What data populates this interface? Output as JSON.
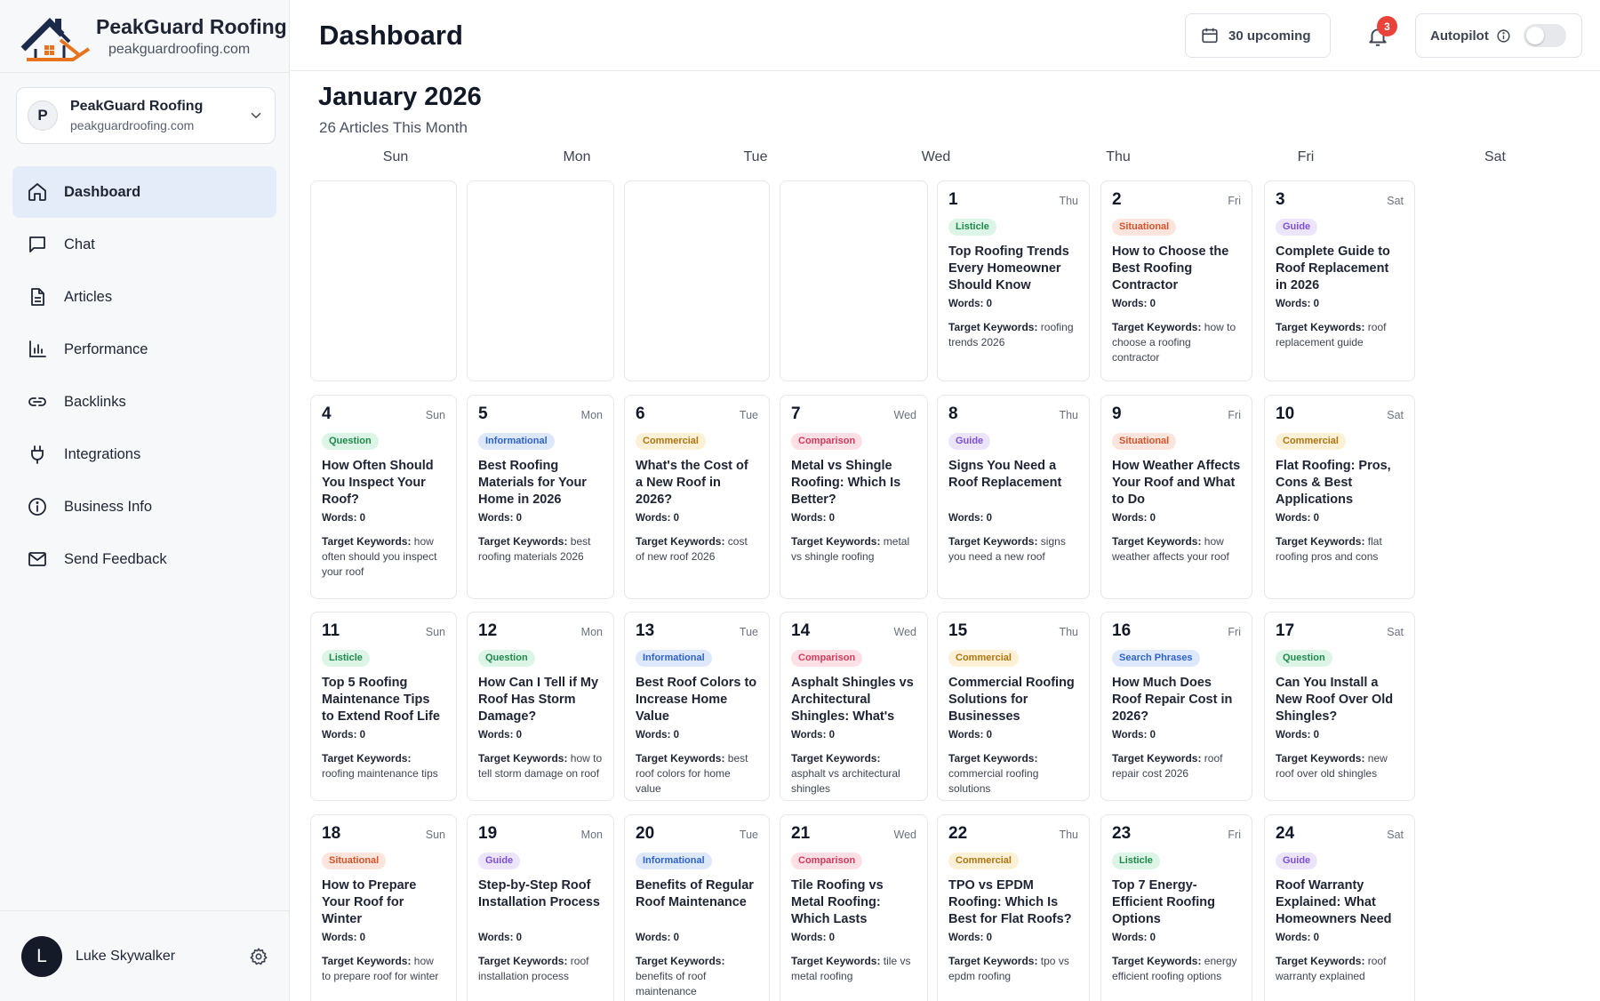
{
  "brand": {
    "name": "PeakGuard Roofing",
    "domain": "peakguardroofing.com"
  },
  "site_selector": {
    "initial": "P",
    "name": "PeakGuard Roofing",
    "domain": "peakguardroofing.com"
  },
  "nav": [
    {
      "label": "Dashboard",
      "icon": "home-icon",
      "active": true
    },
    {
      "label": "Chat",
      "icon": "chat-icon"
    },
    {
      "label": "Articles",
      "icon": "document-icon"
    },
    {
      "label": "Performance",
      "icon": "bar-chart-icon"
    },
    {
      "label": "Backlinks",
      "icon": "link-icon"
    },
    {
      "label": "Integrations",
      "icon": "plug-icon"
    },
    {
      "label": "Business Info",
      "icon": "info-icon"
    },
    {
      "label": "Send Feedback",
      "icon": "mail-icon"
    }
  ],
  "user": {
    "initial": "L",
    "name": "Luke Skywalker"
  },
  "header": {
    "title": "Dashboard",
    "upcoming_label": "30 upcoming",
    "notification_count": "3",
    "autopilot_label": "Autopilot",
    "autopilot_on": false
  },
  "calendar": {
    "month_title": "January 2026",
    "subtitle": "26 Articles This Month",
    "weekdays": [
      "Sun",
      "Mon",
      "Tue",
      "Wed",
      "Thu",
      "Fri",
      "Sat"
    ],
    "words_prefix": "Words:",
    "keywords_prefix": "Target Keywords:",
    "tag_colors": {
      "Listicle": {
        "bg": "#dcf5e6",
        "fg": "#1f8a4c"
      },
      "Situational": {
        "bg": "#fde4dc",
        "fg": "#d4532b"
      },
      "Guide": {
        "bg": "#ece4fb",
        "fg": "#7c4fd4"
      },
      "Question": {
        "bg": "#dcf5e6",
        "fg": "#1f8a4c"
      },
      "Informational": {
        "bg": "#dde9fb",
        "fg": "#2f62c9"
      },
      "Commercial": {
        "bg": "#fcf0d6",
        "fg": "#b07410"
      },
      "Comparison": {
        "bg": "#fde0e6",
        "fg": "#d23a5c"
      },
      "Search Phrases": {
        "bg": "#dde9fb",
        "fg": "#2f62c9"
      }
    },
    "weeks": [
      [
        null,
        null,
        null,
        null,
        {
          "day": "1",
          "dow": "Thu",
          "tag": "Listicle",
          "title": "Top Roofing Trends Every Homeowner Should Know",
          "words": "0",
          "keywords": "roofing trends 2026"
        },
        {
          "day": "2",
          "dow": "Fri",
          "tag": "Situational",
          "title": "How to Choose the Best Roofing Contractor",
          "words": "0",
          "keywords": "how to choose a roofing contractor"
        },
        {
          "day": "3",
          "dow": "Sat",
          "tag": "Guide",
          "title": "Complete Guide to Roof Replacement in 2026",
          "words": "0",
          "keywords": "roof replacement guide"
        }
      ],
      [
        {
          "day": "4",
          "dow": "Sun",
          "tag": "Question",
          "title": "How Often Should You Inspect Your Roof?",
          "words": "0",
          "keywords": "how often should you inspect your roof"
        },
        {
          "day": "5",
          "dow": "Mon",
          "tag": "Informational",
          "title": "Best Roofing Materials for Your Home in 2026",
          "words": "0",
          "keywords": "best roofing materials 2026"
        },
        {
          "day": "6",
          "dow": "Tue",
          "tag": "Commercial",
          "title": "What's the Cost of a New Roof in 2026?",
          "words": "0",
          "keywords": "cost of new roof 2026"
        },
        {
          "day": "7",
          "dow": "Wed",
          "tag": "Comparison",
          "title": "Metal vs Shingle Roofing: Which Is Better?",
          "words": "0",
          "keywords": "metal vs shingle roofing"
        },
        {
          "day": "8",
          "dow": "Thu",
          "tag": "Guide",
          "title": "Signs You Need a Roof Replacement",
          "words": "0",
          "keywords": "signs you need a new roof"
        },
        {
          "day": "9",
          "dow": "Fri",
          "tag": "Situational",
          "title": "How Weather Affects Your Roof and What to Do",
          "words": "0",
          "keywords": "how weather affects your roof"
        },
        {
          "day": "10",
          "dow": "Sat",
          "tag": "Commercial",
          "title": "Flat Roofing: Pros, Cons & Best Applications",
          "words": "0",
          "keywords": "flat roofing pros and cons"
        }
      ],
      [
        {
          "day": "11",
          "dow": "Sun",
          "tag": "Listicle",
          "title": "Top 5 Roofing Maintenance Tips to Extend Roof Life",
          "words": "0",
          "keywords": "roofing maintenance tips"
        },
        {
          "day": "12",
          "dow": "Mon",
          "tag": "Question",
          "title": "How Can I Tell if My Roof Has Storm Damage?",
          "words": "0",
          "keywords": "how to tell storm damage on roof"
        },
        {
          "day": "13",
          "dow": "Tue",
          "tag": "Informational",
          "title": "Best Roof Colors to Increase Home Value",
          "words": "0",
          "keywords": "best roof colors for home value"
        },
        {
          "day": "14",
          "dow": "Wed",
          "tag": "Comparison",
          "title": "Asphalt Shingles vs Architectural Shingles: What's the Difference?",
          "words": "0",
          "keywords": "asphalt vs architectural shingles"
        },
        {
          "day": "15",
          "dow": "Thu",
          "tag": "Commercial",
          "title": "Commercial Roofing Solutions for Businesses",
          "words": "0",
          "keywords": "commercial roofing solutions"
        },
        {
          "day": "16",
          "dow": "Fri",
          "tag": "Search Phrases",
          "title": "How Much Does Roof Repair Cost in 2026?",
          "words": "0",
          "keywords": "roof repair cost 2026"
        },
        {
          "day": "17",
          "dow": "Sat",
          "tag": "Question",
          "title": "Can You Install a New Roof Over Old Shingles?",
          "words": "0",
          "keywords": "new roof over old shingles"
        }
      ],
      [
        {
          "day": "18",
          "dow": "Sun",
          "tag": "Situational",
          "title": "How to Prepare Your Roof for Winter",
          "words": "0",
          "keywords": "how to prepare roof for winter"
        },
        {
          "day": "19",
          "dow": "Mon",
          "tag": "Guide",
          "title": "Step-by-Step Roof Installation Process",
          "words": "0",
          "keywords": "roof installation process"
        },
        {
          "day": "20",
          "dow": "Tue",
          "tag": "Informational",
          "title": "Benefits of Regular Roof Maintenance",
          "words": "0",
          "keywords": "benefits of roof maintenance"
        },
        {
          "day": "21",
          "dow": "Wed",
          "tag": "Comparison",
          "title": "Tile Roofing vs Metal Roofing: Which Lasts Longer?",
          "words": "0",
          "keywords": "tile vs metal roofing"
        },
        {
          "day": "22",
          "dow": "Thu",
          "tag": "Commercial",
          "title": "TPO vs EPDM Roofing: Which Is Best for Flat Roofs?",
          "words": "0",
          "keywords": "tpo vs epdm roofing"
        },
        {
          "day": "23",
          "dow": "Fri",
          "tag": "Listicle",
          "title": "Top 7 Energy-Efficient Roofing Options",
          "words": "0",
          "keywords": "energy efficient roofing options"
        },
        {
          "day": "24",
          "dow": "Sat",
          "tag": "Guide",
          "title": "Roof Warranty Explained: What Homeowners Need to Know",
          "words": "0",
          "keywords": "roof warranty explained"
        }
      ]
    ]
  }
}
